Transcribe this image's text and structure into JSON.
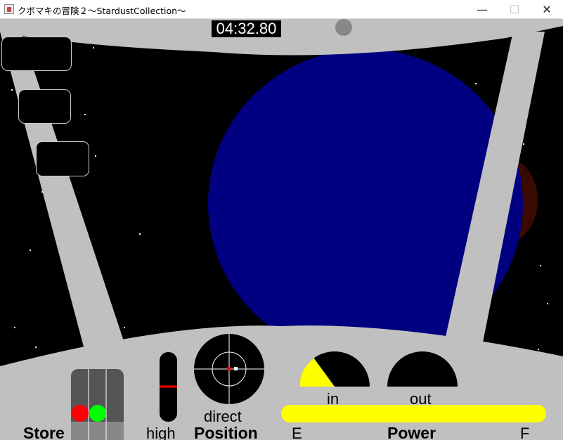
{
  "window": {
    "title": "クボマキの冒険２〜StardustCollection〜",
    "minimize_glyph": "—",
    "maximize_glyph": "☐",
    "close_glyph": "✕"
  },
  "hud": {
    "timer": "04:32.80",
    "store_label": "Store",
    "high_label": "high",
    "direct_label": "direct",
    "position_label": "Position",
    "in_label": "in",
    "out_label": "out",
    "power_label": "Power",
    "e_label": "E",
    "f_label": "F",
    "in_gauge_level": 0.3,
    "out_gauge_level": 0.0,
    "power_level": 1.0
  },
  "colors": {
    "space": "#000000",
    "cockpit": "#c0c0c0",
    "planet": "#000080",
    "planet_far": "#3a0a00",
    "gauge_fill": "#ffff00",
    "light_red": "#ff0000",
    "light_green": "#00ff00",
    "altitude_marker": "#ff0000"
  },
  "icons": {
    "app": "java-coffee-icon",
    "status_light": "gray-circle-icon"
  }
}
